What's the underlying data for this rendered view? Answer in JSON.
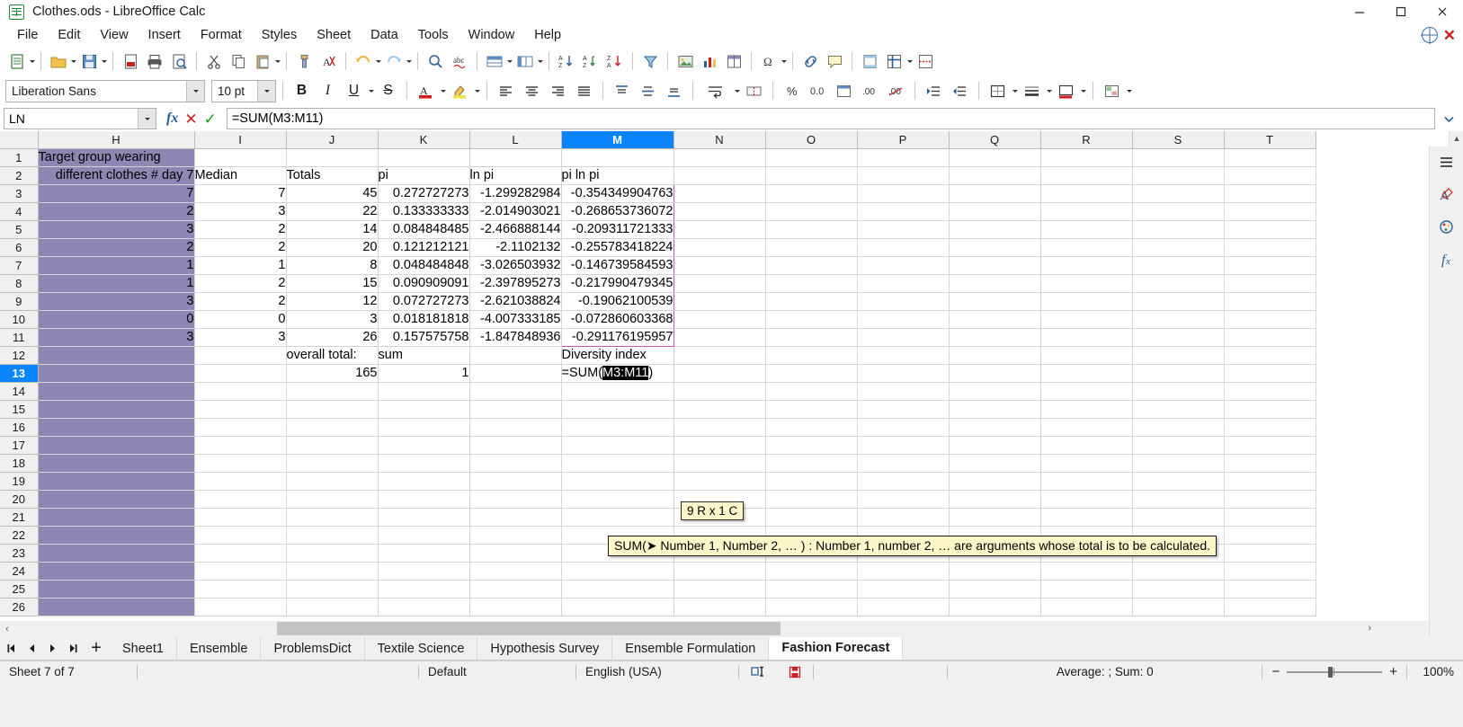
{
  "window": {
    "title": "Clothes.ods - LibreOffice Calc",
    "icon": "calc-document-icon",
    "minimize": "minimize-button",
    "maximize": "maximize-button",
    "close": "close-button"
  },
  "menubar": {
    "items": [
      {
        "label": "File"
      },
      {
        "label": "Edit"
      },
      {
        "label": "View"
      },
      {
        "label": "Insert"
      },
      {
        "label": "Format"
      },
      {
        "label": "Styles"
      },
      {
        "label": "Sheet"
      },
      {
        "label": "Data"
      },
      {
        "label": "Tools"
      },
      {
        "label": "Window"
      },
      {
        "label": "Help"
      }
    ]
  },
  "formatbar": {
    "font_name": "Liberation Sans",
    "font_size": "10 pt",
    "bold": "B",
    "italic": "I",
    "underline": "U"
  },
  "formulabar": {
    "name_box": "LN",
    "input_line": "=SUM(M3:M11)",
    "fx": "fx",
    "reject": "✕",
    "accept": "✓"
  },
  "grid": {
    "columns": [
      "H",
      "I",
      "J",
      "K",
      "L",
      "M",
      "N",
      "O",
      "P",
      "Q",
      "R",
      "S",
      "T"
    ],
    "selected_column": "M",
    "selected_row": 13,
    "rows": [
      {
        "n": 1,
        "cells": [
          "Target group wearing",
          "",
          "",
          "",
          "",
          "",
          "",
          "",
          "",
          "",
          "",
          "",
          ""
        ]
      },
      {
        "n": 2,
        "cells": [
          "different clothes # day 7",
          "Median",
          "Totals",
          "pi",
          "ln pi",
          "pi ln pi",
          "",
          "",
          "",
          "",
          "",
          "",
          ""
        ]
      },
      {
        "n": 3,
        "cells": [
          "7",
          "7",
          "45",
          "0.272727273",
          "-1.299282984",
          "-0.354349904763",
          "",
          "",
          "",
          "",
          "",
          "",
          ""
        ]
      },
      {
        "n": 4,
        "cells": [
          "2",
          "3",
          "22",
          "0.133333333",
          "-2.014903021",
          "-0.268653736072",
          "",
          "",
          "",
          "",
          "",
          "",
          ""
        ]
      },
      {
        "n": 5,
        "cells": [
          "3",
          "2",
          "14",
          "0.084848485",
          "-2.466888144",
          "-0.209311721333",
          "",
          "",
          "",
          "",
          "",
          "",
          ""
        ]
      },
      {
        "n": 6,
        "cells": [
          "2",
          "2",
          "20",
          "0.121212121",
          "-2.1102132",
          "-0.255783418224",
          "",
          "",
          "",
          "",
          "",
          "",
          ""
        ]
      },
      {
        "n": 7,
        "cells": [
          "1",
          "1",
          "8",
          "0.048484848",
          "-3.026503932",
          "-0.146739584593",
          "",
          "",
          "",
          "",
          "",
          "",
          ""
        ]
      },
      {
        "n": 8,
        "cells": [
          "1",
          "2",
          "15",
          "0.090909091",
          "-2.397895273",
          "-0.217990479345",
          "",
          "",
          "",
          "",
          "",
          "",
          ""
        ]
      },
      {
        "n": 9,
        "cells": [
          "3",
          "2",
          "12",
          "0.072727273",
          "-2.621038824",
          "-0.19062100539",
          "",
          "",
          "",
          "",
          "",
          "",
          ""
        ]
      },
      {
        "n": 10,
        "cells": [
          "0",
          "0",
          "3",
          "0.018181818",
          "-4.007333185",
          "-0.072860603368",
          "",
          "",
          "",
          "",
          "",
          "",
          ""
        ]
      },
      {
        "n": 11,
        "cells": [
          "3",
          "3",
          "26",
          "0.157575758",
          "-1.847848936",
          "-0.291176195957",
          "",
          "",
          "",
          "",
          "",
          "",
          ""
        ]
      },
      {
        "n": 12,
        "cells": [
          "",
          "",
          "overall total:",
          "sum",
          "",
          "Diversity index",
          "",
          "",
          "",
          "",
          "",
          "",
          ""
        ]
      },
      {
        "n": 13,
        "cells": [
          "",
          "",
          "165",
          "1",
          "",
          "",
          "",
          "",
          "",
          "",
          "",
          "",
          ""
        ]
      },
      {
        "n": 14,
        "cells": [
          "",
          "",
          "",
          "",
          "",
          "",
          "",
          "",
          "",
          "",
          "",
          "",
          ""
        ]
      },
      {
        "n": 15,
        "cells": [
          "",
          "",
          "",
          "",
          "",
          "",
          "",
          "",
          "",
          "",
          "",
          "",
          ""
        ]
      },
      {
        "n": 16,
        "cells": [
          "",
          "",
          "",
          "",
          "",
          "",
          "",
          "",
          "",
          "",
          "",
          "",
          ""
        ]
      },
      {
        "n": 17,
        "cells": [
          "",
          "",
          "",
          "",
          "",
          "",
          "",
          "",
          "",
          "",
          "",
          "",
          ""
        ]
      },
      {
        "n": 18,
        "cells": [
          "",
          "",
          "",
          "",
          "",
          "",
          "",
          "",
          "",
          "",
          "",
          "",
          ""
        ]
      },
      {
        "n": 19,
        "cells": [
          "",
          "",
          "",
          "",
          "",
          "",
          "",
          "",
          "",
          "",
          "",
          "",
          ""
        ]
      },
      {
        "n": 20,
        "cells": [
          "",
          "",
          "",
          "",
          "",
          "",
          "",
          "",
          "",
          "",
          "",
          "",
          ""
        ]
      },
      {
        "n": 21,
        "cells": [
          "",
          "",
          "",
          "",
          "",
          "",
          "",
          "",
          "",
          "",
          "",
          "",
          ""
        ]
      },
      {
        "n": 22,
        "cells": [
          "",
          "",
          "",
          "",
          "",
          "",
          "",
          "",
          "",
          "",
          "",
          "",
          ""
        ]
      },
      {
        "n": 23,
        "cells": [
          "",
          "",
          "",
          "",
          "",
          "",
          "",
          "",
          "",
          "",
          "",
          "",
          ""
        ]
      },
      {
        "n": 24,
        "cells": [
          "",
          "",
          "",
          "",
          "",
          "",
          "",
          "",
          "",
          "",
          "",
          "",
          ""
        ]
      },
      {
        "n": 25,
        "cells": [
          "",
          "",
          "",
          "",
          "",
          "",
          "",
          "",
          "",
          "",
          "",
          "",
          ""
        ]
      },
      {
        "n": 26,
        "cells": [
          "",
          "",
          "",
          "",
          "",
          "",
          "",
          "",
          "",
          "",
          "",
          "",
          ""
        ]
      }
    ],
    "editing_cell": {
      "address": "M13",
      "prefix": "=SUM(",
      "highlight": "M3:M11",
      "suffix": ")"
    },
    "range_tooltip": "9 R x 1 C",
    "function_tooltip": "SUM(➤ Number 1, Number 2, …  ) : Number 1, number 2, … are arguments whose total is to be calculated.",
    "fill_color": "#8d87b3",
    "selection_color": "#c455c4",
    "header_selected_color": "#0a84ff"
  },
  "tabs": {
    "items": [
      {
        "label": "Sheet1",
        "active": false
      },
      {
        "label": "Ensemble",
        "active": false
      },
      {
        "label": "ProblemsDict",
        "active": false
      },
      {
        "label": "Textile Science",
        "active": false
      },
      {
        "label": "Hypothesis Survey",
        "active": false
      },
      {
        "label": "Ensemble Formulation",
        "active": false
      },
      {
        "label": "Fashion Forecast",
        "active": true
      }
    ]
  },
  "statusbar": {
    "sheet_count": "Sheet 7 of 7",
    "page_style": "Default",
    "language": "English (USA)",
    "selection_mode_icon": "selection-mode-icon",
    "save_state_icon": "unsaved-changes-icon",
    "summary": "Average: ; Sum: 0",
    "zoom_out": "−",
    "zoom_in": "+",
    "zoom_level": "100%"
  }
}
